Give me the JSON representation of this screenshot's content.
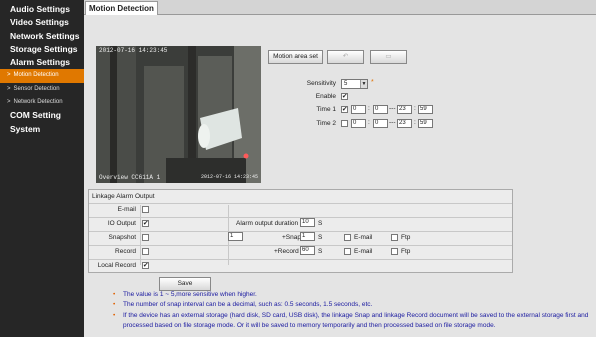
{
  "sidebar": {
    "items": [
      {
        "label": "Audio Settings",
        "level": "main"
      },
      {
        "label": "Video Settings",
        "level": "main"
      },
      {
        "label": "Network Settings",
        "level": "main"
      },
      {
        "label": "Storage Settings",
        "level": "main"
      },
      {
        "label": "Alarm Settings",
        "level": "main"
      },
      {
        "label": "Motion Detection",
        "level": "sub",
        "active": true
      },
      {
        "label": "Sensor Detection",
        "level": "sub"
      },
      {
        "label": "Network Detection",
        "level": "sub"
      },
      {
        "label": "COM Setting",
        "level": "main"
      },
      {
        "label": "System",
        "level": "main"
      }
    ]
  },
  "tab": {
    "title": "Motion Detection"
  },
  "video": {
    "timestamp": "2012-07-16  14:23:45",
    "channel": "Overview CC611A 1",
    "date_overlay": "2012-07-16 14:23:45"
  },
  "toolbar": {
    "area_set_label": "Motion area set"
  },
  "motion": {
    "sensitivity_label": "Sensitivity",
    "sensitivity_value": "5",
    "enable_label": "Enable",
    "enable_checked": "✔",
    "time1_label": "Time 1",
    "time1_checked": "✔",
    "time1": {
      "h1": "0",
      "m1": "0",
      "h2": "23",
      "m2": "59"
    },
    "time2_label": "Time 2",
    "time2_checked": "",
    "time2": {
      "h1": "0",
      "m1": "0",
      "h2": "23",
      "m2": "59"
    },
    "colon": ":",
    "dash": "---",
    "star": "*"
  },
  "linkage": {
    "title": "Linkage Alarm Output",
    "email_label": "E-mail",
    "io_label": "IO Output",
    "io_checked": "✔",
    "alarm_duration_label": "Alarm output duration",
    "alarm_duration_value": "10",
    "seconds_unit": "S",
    "snapshot_label": "Snapshot",
    "snapshot_count": "1",
    "snap_label": "+Snap",
    "snap_value": "1",
    "record_label": "Record",
    "record_plus_label": "+Record",
    "record_value": "60",
    "email_opt": "E-mail",
    "ftp_opt": "Ftp",
    "local_record_label": "Local Record",
    "local_record_checked": "✔"
  },
  "save_label": "Save",
  "notes": [
    "The value is 1 ~ 5,more sensitive when higher.",
    "The number of snap interval can be a decimal, such as: 0.5 seconds, 1.5 seconds, etc.",
    "If the device has an external storage (hard disk, SD card, USB disk), the linkage Snap and linkage Record document will be saved to the external storage first and",
    "processed based on file storage mode. Or it will be saved to memory temporarily and then processed based on file storage mode."
  ],
  "colors": {
    "accent": "#e07800",
    "sidebar_bg": "#262626",
    "note_text": "#1a1aa0"
  }
}
